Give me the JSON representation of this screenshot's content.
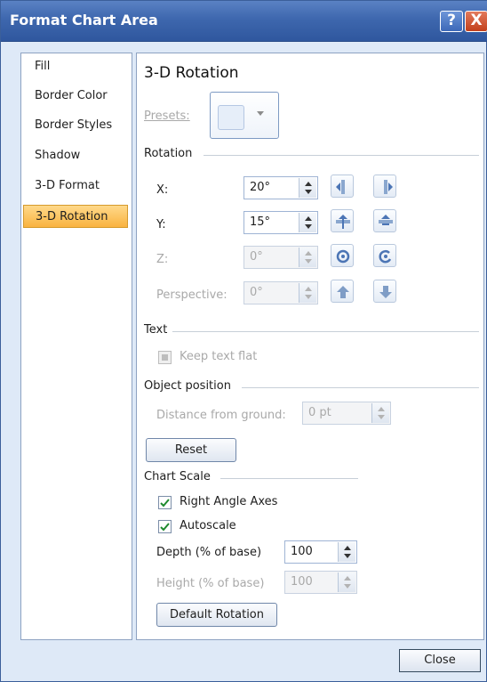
{
  "window": {
    "title": "Format Chart Area"
  },
  "titlebar_buttons": {
    "help": "?",
    "close": "X"
  },
  "sidebar": {
    "items": [
      {
        "label": "Fill"
      },
      {
        "label": "Border Color"
      },
      {
        "label": "Border Styles"
      },
      {
        "label": "Shadow"
      },
      {
        "label": "3-D Format"
      },
      {
        "label": "3-D Rotation",
        "selected": true
      }
    ]
  },
  "panel": {
    "title": "3-D Rotation",
    "presets_label": "Presets:",
    "rotation_section": "Rotation",
    "x_label": "X:",
    "x_value": "20°",
    "y_label": "Y:",
    "y_value": "15°",
    "z_label": "Z:",
    "z_value": "0°",
    "perspective_label": "Perspective:",
    "perspective_value": "0°",
    "text_section": "Text",
    "keep_text_flat": "Keep text flat",
    "object_position_section": "Object position",
    "distance_label": "Distance from ground:",
    "distance_value": "0 pt",
    "reset_label": "Reset",
    "chart_scale_section": "Chart Scale",
    "right_angle_axes": "Right Angle Axes",
    "right_angle_axes_checked": true,
    "autoscale": "Autoscale",
    "autoscale_checked": true,
    "depth_label": "Depth (% of base)",
    "depth_value": "100",
    "height_label": "Height (% of base)",
    "height_value": "100",
    "default_rotation_label": "Default Rotation"
  },
  "footer": {
    "close_label": "Close"
  },
  "colors": {
    "titlebar": "#3e67ae",
    "selected_item": "#f9b340",
    "disabled_text": "#a9a9a9"
  }
}
